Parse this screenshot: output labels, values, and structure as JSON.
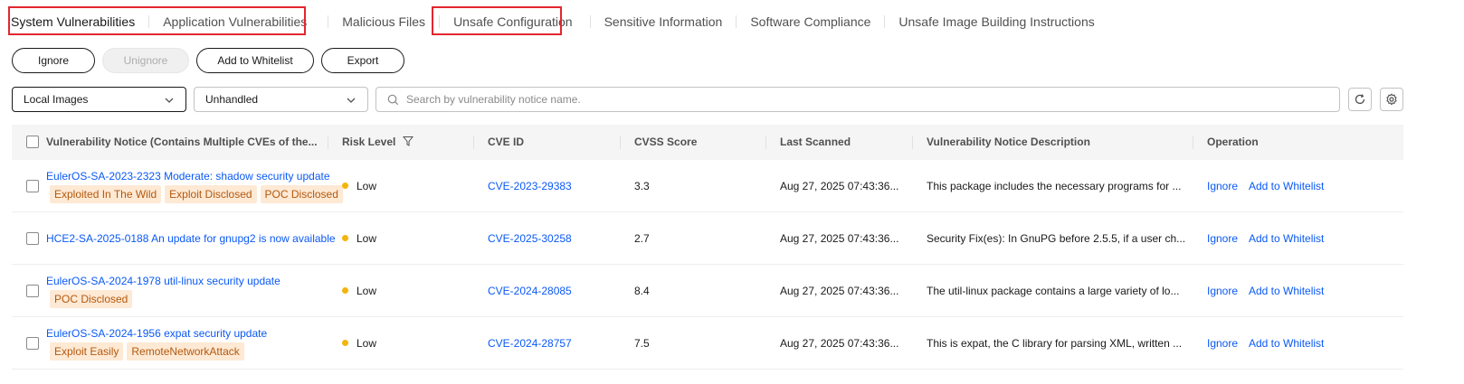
{
  "tabs": [
    {
      "label": "System Vulnerabilities"
    },
    {
      "label": "Application Vulnerabilities"
    },
    {
      "label": "Malicious Files"
    },
    {
      "label": "Unsafe Configuration"
    },
    {
      "label": "Sensitive Information"
    },
    {
      "label": "Software Compliance"
    },
    {
      "label": "Unsafe Image Building Instructions"
    }
  ],
  "actions": {
    "ignore": "Ignore",
    "unignore": "Unignore",
    "add_whitelist": "Add to Whitelist",
    "export": "Export"
  },
  "filters": {
    "image_scope": "Local Images",
    "status": "Unhandled",
    "search_placeholder": "Search by vulnerability notice name."
  },
  "table": {
    "columns": {
      "notice": "Vulnerability Notice (Contains Multiple CVEs of the...",
      "risk": "Risk Level",
      "cve": "CVE ID",
      "cvss": "CVSS Score",
      "scanned": "Last Scanned",
      "description": "Vulnerability Notice Description",
      "operation": "Operation"
    },
    "rows": [
      {
        "notice": "EulerOS-SA-2023-2323 Moderate: shadow security update",
        "tags": [
          "Exploited In The Wild",
          "Exploit Disclosed",
          "POC Disclosed"
        ],
        "risk": "Low",
        "cve": "CVE-2023-29383",
        "cvss": "3.3",
        "scanned": "Aug 27, 2025 07:43:36...",
        "description": "This package includes the necessary programs for ...",
        "op_ignore": "Ignore",
        "op_whitelist": "Add to Whitelist"
      },
      {
        "notice": "HCE2-SA-2025-0188 An update for gnupg2 is now available",
        "tags": [],
        "risk": "Low",
        "cve": "CVE-2025-30258",
        "cvss": "2.7",
        "scanned": "Aug 27, 2025 07:43:36...",
        "description": "Security Fix(es): In GnuPG before 2.5.5, if a user ch...",
        "op_ignore": "Ignore",
        "op_whitelist": "Add to Whitelist"
      },
      {
        "notice": "EulerOS-SA-2024-1978 util-linux security update",
        "tags": [
          "POC Disclosed"
        ],
        "risk": "Low",
        "cve": "CVE-2024-28085",
        "cvss": "8.4",
        "scanned": "Aug 27, 2025 07:43:36...",
        "description": "The util-linux package contains a large variety of lo...",
        "op_ignore": "Ignore",
        "op_whitelist": "Add to Whitelist"
      },
      {
        "notice": "EulerOS-SA-2024-1956 expat security update",
        "tags": [
          "Exploit Easily",
          "RemoteNetworkAttack"
        ],
        "risk": "Low",
        "cve": "CVE-2024-28757",
        "cvss": "7.5",
        "scanned": "Aug 27, 2025 07:43:36...",
        "description": "This is expat, the C library for parsing XML, written ...",
        "op_ignore": "Ignore",
        "op_whitelist": "Add to Whitelist"
      }
    ]
  },
  "colors": {
    "link": "#0a59f7",
    "highlight": "#e3262f",
    "tag_bg": "#fee9d4",
    "tag_text": "#b3590f",
    "risk_low": "#f5b40c"
  }
}
